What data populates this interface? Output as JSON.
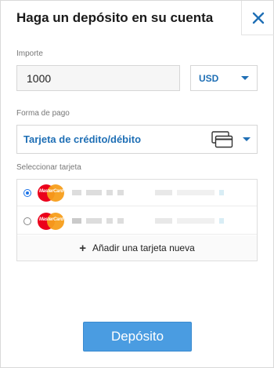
{
  "dialog": {
    "title": "Haga un depósito en su cuenta"
  },
  "amount": {
    "label": "Importe",
    "value": "1000"
  },
  "currency": {
    "selected": "USD"
  },
  "payment_method": {
    "label": "Forma de pago",
    "selected": "Tarjeta de crédito/débito",
    "icon": "credit-card-icon"
  },
  "cards": {
    "label": "Seleccionar tarjeta",
    "items": [
      {
        "brand": "MasterCard",
        "selected": true
      },
      {
        "brand": "MasterCard",
        "selected": false
      }
    ],
    "add_label": "Añadir una tarjeta nueva"
  },
  "actions": {
    "deposit_label": "Depósito"
  },
  "colors": {
    "accent": "#1f6fb5",
    "button": "#4a9ce1"
  }
}
